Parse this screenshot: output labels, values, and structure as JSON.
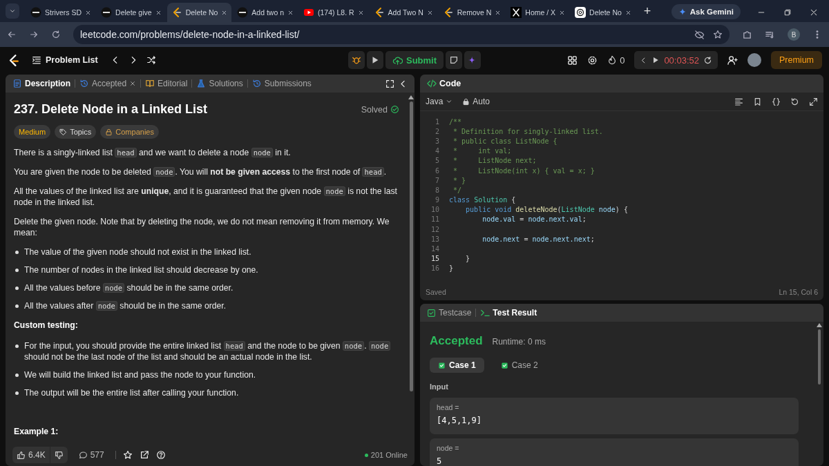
{
  "browser": {
    "tabs": [
      {
        "title": "Strivers SD",
        "kind": "tuf",
        "selected": false
      },
      {
        "title": "Delete give",
        "kind": "tuf",
        "selected": false
      },
      {
        "title": "Delete No",
        "kind": "leetcode",
        "selected": true
      },
      {
        "title": "Add two n",
        "kind": "tuf",
        "selected": false
      },
      {
        "title": "(174) L8. R",
        "kind": "youtube",
        "selected": false
      },
      {
        "title": "Add Two N",
        "kind": "leetcode",
        "selected": false
      },
      {
        "title": "Remove N",
        "kind": "leetcode",
        "selected": false
      },
      {
        "title": "Home / X",
        "kind": "x",
        "selected": false
      },
      {
        "title": "Delete No",
        "kind": "chatgpt",
        "selected": false
      }
    ],
    "new_tab": "+",
    "ask_gemini": "Ask Gemini",
    "url": "leetcode.com/problems/delete-node-in-a-linked-list/",
    "profile": "B"
  },
  "toolbar": {
    "problem_list": "Problem List",
    "submit": "Submit",
    "streak": "0",
    "timer": "00:03:52",
    "premium": "Premium"
  },
  "description_panel": {
    "tabs": [
      {
        "label": "Description",
        "selected": true,
        "closable": false
      },
      {
        "label": "Accepted",
        "selected": false,
        "closable": true
      },
      {
        "label": "Editorial",
        "selected": false,
        "closable": false
      },
      {
        "label": "Solutions",
        "selected": false,
        "closable": false
      },
      {
        "label": "Submissions",
        "selected": false,
        "closable": false
      }
    ],
    "title": "237. Delete Node in a Linked List",
    "status": "Solved",
    "tags": [
      {
        "label": "Medium",
        "kind": "difficulty"
      },
      {
        "label": "Topics",
        "kind": "topics"
      },
      {
        "label": "Companies",
        "kind": "companies"
      }
    ],
    "blocks": [
      {
        "kind": "para",
        "segments": [
          {
            "text": "There is a singly-linked list "
          },
          {
            "text": "head",
            "code": true
          },
          {
            "text": " and we want to delete a node "
          },
          {
            "text": "node",
            "code": true
          },
          {
            "text": " in it."
          }
        ]
      },
      {
        "kind": "para",
        "segments": [
          {
            "text": "You are given the node to be deleted "
          },
          {
            "text": "node",
            "code": true
          },
          {
            "text": ". You will **not be given access** to the first node of "
          },
          {
            "text": "head",
            "code": true
          },
          {
            "text": "."
          }
        ]
      },
      {
        "kind": "para",
        "segments": [
          {
            "text": "All the values of the linked list are **unique**, and it is guaranteed that the given node "
          },
          {
            "text": "node",
            "code": true
          },
          {
            "text": " is not the last node in the linked list."
          }
        ]
      },
      {
        "kind": "para",
        "segments": [
          {
            "text": "Delete the given node. Note that by deleting the node, we do not mean removing it from memory. We mean:"
          }
        ]
      },
      {
        "kind": "bullet",
        "segments": [
          {
            "text": "The value of the given node should not exist in the linked list."
          }
        ]
      },
      {
        "kind": "bullet",
        "segments": [
          {
            "text": "The number of nodes in the linked list should decrease by one."
          }
        ]
      },
      {
        "kind": "bullet",
        "segments": [
          {
            "text": "All the values before "
          },
          {
            "text": "node",
            "code": true
          },
          {
            "text": " should be in the same order."
          }
        ]
      },
      {
        "kind": "bullet",
        "segments": [
          {
            "text": "All the values after "
          },
          {
            "text": "node",
            "code": true
          },
          {
            "text": " should be in the same order."
          }
        ]
      },
      {
        "kind": "heading",
        "segments": [
          {
            "text": "Custom testing:"
          }
        ]
      },
      {
        "kind": "bullet",
        "segments": [
          {
            "text": "For the input, you should provide the entire linked list "
          },
          {
            "text": "head",
            "code": true
          },
          {
            "text": " and the node to be given "
          },
          {
            "text": "node",
            "code": true
          },
          {
            "text": ". "
          },
          {
            "text": "node",
            "code": true
          },
          {
            "text": " should not be the last node of the list and should be an actual node in the list."
          }
        ]
      },
      {
        "kind": "bullet",
        "segments": [
          {
            "text": "We will build the linked list and pass the node to your function."
          }
        ]
      },
      {
        "kind": "bullet",
        "segments": [
          {
            "text": "The output will be the entire list after calling your function."
          }
        ]
      },
      {
        "kind": "heading",
        "segments": [
          {
            "text": "Example 1:"
          }
        ]
      }
    ],
    "likes": "6.4K",
    "comments": "577",
    "online": "201 Online"
  },
  "code_panel": {
    "title": "Code",
    "language": "Java",
    "mode": "Auto",
    "lines": [
      {
        "number": "1",
        "current": false,
        "tokens": [
          {
            "text": "/**",
            "kind": "comment"
          }
        ]
      },
      {
        "number": "2",
        "current": false,
        "tokens": [
          {
            "text": " * Definition for singly-linked list.",
            "kind": "comment"
          }
        ]
      },
      {
        "number": "3",
        "current": false,
        "tokens": [
          {
            "text": " * public class ListNode {",
            "kind": "comment"
          }
        ]
      },
      {
        "number": "4",
        "current": false,
        "tokens": [
          {
            "text": " *     int val;",
            "kind": "comment"
          }
        ]
      },
      {
        "number": "5",
        "current": false,
        "tokens": [
          {
            "text": " *     ListNode next;",
            "kind": "comment"
          }
        ]
      },
      {
        "number": "6",
        "current": false,
        "tokens": [
          {
            "text": " *     ListNode(int x) { val = x; }",
            "kind": "comment"
          }
        ]
      },
      {
        "number": "7",
        "current": false,
        "tokens": [
          {
            "text": " * }",
            "kind": "comment"
          }
        ]
      },
      {
        "number": "8",
        "current": false,
        "tokens": [
          {
            "text": " */",
            "kind": "comment"
          }
        ]
      },
      {
        "number": "9",
        "current": false,
        "tokens": [
          {
            "text": "class ",
            "kind": "keyword"
          },
          {
            "text": "Solution",
            "kind": "type"
          },
          {
            "text": " {",
            "kind": "plain"
          }
        ]
      },
      {
        "number": "10",
        "current": false,
        "tokens": [
          {
            "text": "    public void ",
            "kind": "keyword"
          },
          {
            "text": "deleteNode",
            "kind": "function"
          },
          {
            "text": "(",
            "kind": "plain"
          },
          {
            "text": "ListNode",
            "kind": "type"
          },
          {
            "text": " node",
            "kind": "variable"
          },
          {
            "text": ") {",
            "kind": "plain"
          }
        ]
      },
      {
        "number": "11",
        "current": false,
        "tokens": [
          {
            "text": "        node.val",
            "kind": "variable"
          },
          {
            "text": " = ",
            "kind": "plain"
          },
          {
            "text": "node.next.val",
            "kind": "variable"
          },
          {
            "text": ";",
            "kind": "plain"
          }
        ]
      },
      {
        "number": "12",
        "current": false
      },
      {
        "number": "13",
        "current": false,
        "tokens": [
          {
            "text": "        node.next",
            "kind": "variable"
          },
          {
            "text": " = ",
            "kind": "plain"
          },
          {
            "text": "node.next.next",
            "kind": "variable"
          },
          {
            "text": ";",
            "kind": "plain"
          }
        ]
      },
      {
        "number": "14",
        "current": false
      },
      {
        "number": "15",
        "current": true,
        "tokens": [
          {
            "text": "    }",
            "kind": "plain"
          }
        ]
      },
      {
        "number": "16",
        "current": false,
        "tokens": [
          {
            "text": "}",
            "kind": "plain"
          }
        ]
      }
    ],
    "save_status": "Saved",
    "cursor": "Ln 15, Col 6"
  },
  "test_panel": {
    "tabs": [
      {
        "label": "Testcase",
        "selected": false
      },
      {
        "label": "Test Result",
        "selected": true
      }
    ],
    "verdict": "Accepted",
    "runtime": "Runtime: 0 ms",
    "cases": [
      {
        "label": "Case 1",
        "selected": true
      },
      {
        "label": "Case 2",
        "selected": false
      }
    ],
    "input_label": "Input",
    "inputs": [
      {
        "name": "head =",
        "value": "[4,5,1,9]"
      },
      {
        "name": "node =",
        "value": "5"
      }
    ]
  }
}
